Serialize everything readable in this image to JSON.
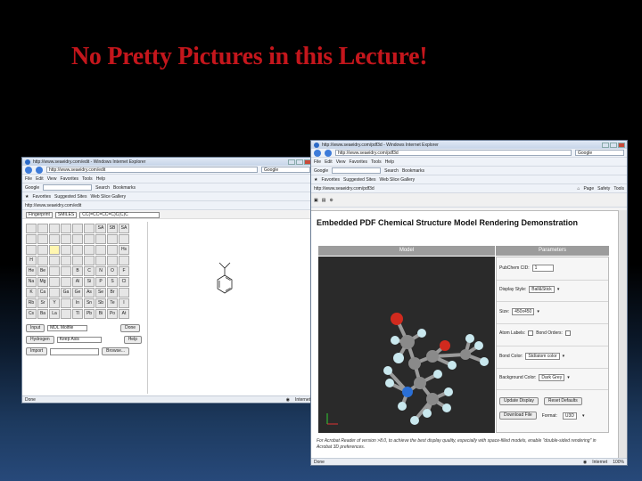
{
  "slide": {
    "title": "No Pretty Pictures in this Lecture!"
  },
  "left_window": {
    "title": "http://www.seaeidry.com/edit - Windows Internet Explorer",
    "address": "http://www.seaeidry.com/edit",
    "search_engine": "Google",
    "menu": [
      "File",
      "Edit",
      "View",
      "Favorites",
      "Tools",
      "Help"
    ],
    "toolbar": [
      "Google",
      "Search",
      "Bookmarks"
    ],
    "favorites": [
      "Favorites",
      "Suggested Sites",
      "Web Slice Gallery"
    ],
    "editor": {
      "format_select": "Fingerprint",
      "smiles_select": "SMILES",
      "smiles_value": "CC(=CC=CC=C)C(C)C",
      "tool_rows": [
        [
          "",
          "",
          "",
          "",
          "",
          "",
          "SA",
          "SB",
          "SA"
        ],
        [
          "",
          "",
          "",
          "",
          "",
          "",
          "",
          "",
          ""
        ],
        [
          "",
          "",
          "",
          "",
          "",
          "",
          "",
          "",
          "Hs"
        ],
        [
          "H",
          "",
          "",
          "",
          "",
          "",
          "",
          "",
          ""
        ],
        [
          "He",
          "Be",
          "",
          "",
          "B",
          "C",
          "N",
          "O",
          "F"
        ],
        [
          "Na",
          "Mg",
          "",
          "",
          "Al",
          "Si",
          "P",
          "S",
          "Cl"
        ],
        [
          "K",
          "Ca",
          "",
          "Ga",
          "Ge",
          "As",
          "Se",
          "Br",
          ""
        ],
        [
          "Rb",
          "Sr",
          "Y",
          "",
          "In",
          "Sn",
          "Sb",
          "Te",
          "I"
        ],
        [
          "Cs",
          "Ba",
          "La",
          "",
          "Tl",
          "Pb",
          "Bi",
          "Po",
          "At"
        ]
      ],
      "input_label": "Input",
      "input_mode": "MDL Molfile",
      "done_label": "Done",
      "hydrogen_label": "Hydrogen",
      "hydrogen_mode": "Keep Asis",
      "help_label": "Help",
      "import_label": "Import",
      "browse_label": "Browse..."
    },
    "status": {
      "left": "Done",
      "zone": "Internet",
      "zoom": "100%"
    }
  },
  "right_window": {
    "title": "http://www.seaeidry.com/pdf3d - Windows Internet Explorer",
    "address": "http://www.seaeidry.com/pdf3d",
    "search_engine": "Google",
    "menu": [
      "File",
      "Edit",
      "View",
      "Favorites",
      "Tools",
      "Help"
    ],
    "toolbar": [
      "Google",
      "Search",
      "Bookmarks"
    ],
    "favorites": [
      "Favorites",
      "Suggested Sites",
      "Web Slice Gallery"
    ],
    "tab_address": "http://www.seaeidry.com/pdf3d",
    "commands": [
      "Page",
      "Safety",
      "Tools"
    ],
    "pdf": {
      "title": "Embedded PDF Chemical Structure Model Rendering Demonstration",
      "col_model": "Model",
      "col_params": "Parameters",
      "pubchem_label": "PubChem CID:",
      "pubchem_value": "1",
      "display_style_label": "Display Style:",
      "display_style_value": "Ball&Stick",
      "size_label": "Size:",
      "size_value": "450x450",
      "atom_labels_label": "Atom Labels:",
      "bond_orders_label": "Bond Orders:",
      "bond_color_label": "Bond Color:",
      "bond_color_value": "Std/atom color",
      "background_color_label": "Background Color:",
      "background_color_value": "Dark Grey",
      "btn_update": "Update Display",
      "btn_reset": "Reset Defaults",
      "btn_download": "Download File",
      "format_label": "Format:",
      "format_value": "U3D",
      "footnote": "For Acrobat Reader of version >8.0, to achieve the best display quality, especially with space-filled models, enable \"double-sided rendering\" in Acrobat 3D preferences."
    },
    "status": {
      "left": "Done",
      "zone": "Internet",
      "zoom": "100%"
    }
  },
  "molecule_colors": {
    "carbon": "#8a8a8a",
    "hydrogen": "#c9e8ee",
    "oxygen": "#d12a1e",
    "nitrogen": "#2a6fd6",
    "bond": "#9a9a9a"
  }
}
